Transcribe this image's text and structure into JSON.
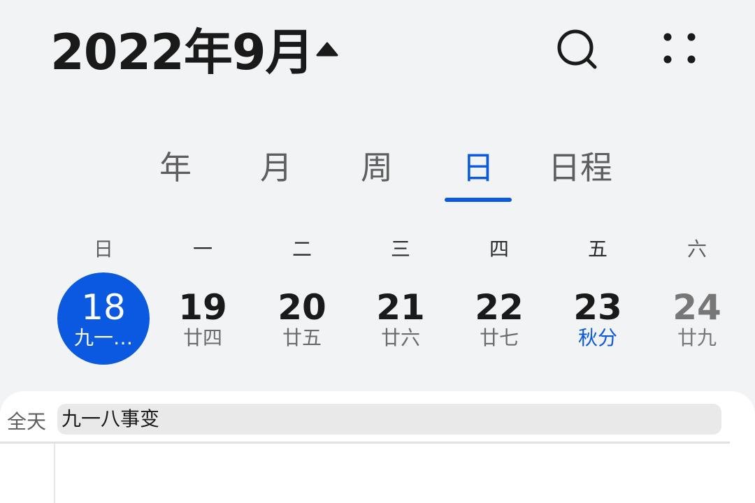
{
  "header": {
    "month_title": "2022年9月",
    "toggle_icon": "caret-up-icon",
    "search_icon": "search-icon",
    "more_icon": "more-dots-icon"
  },
  "tabs": [
    {
      "label": "年",
      "active": false
    },
    {
      "label": "月",
      "active": false
    },
    {
      "label": "周",
      "active": false
    },
    {
      "label": "日",
      "active": true
    },
    {
      "label": "日程",
      "active": false
    }
  ],
  "week": {
    "weekdays": [
      "日",
      "一",
      "二",
      "三",
      "四",
      "五",
      "六"
    ],
    "days": [
      {
        "num": "18",
        "lunar": "九一…",
        "selected": true
      },
      {
        "num": "19",
        "lunar": "廿四"
      },
      {
        "num": "20",
        "lunar": "廿五"
      },
      {
        "num": "21",
        "lunar": "廿六"
      },
      {
        "num": "22",
        "lunar": "廿七"
      },
      {
        "num": "23",
        "lunar": "秋分",
        "solar_term": true
      },
      {
        "num": "24",
        "lunar": "廿九"
      }
    ]
  },
  "allday": {
    "label": "全天",
    "events": [
      {
        "title": "九一八事变"
      }
    ]
  },
  "colors": {
    "accent": "#0a59e0",
    "background": "#f1f3f5",
    "card": "#ffffff"
  }
}
